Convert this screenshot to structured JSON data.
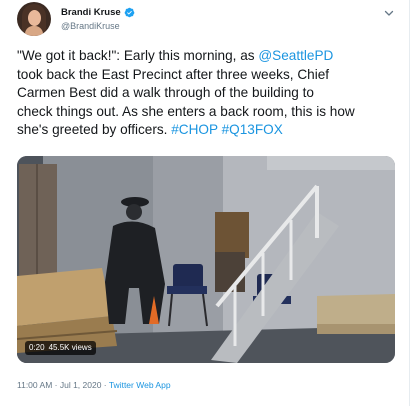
{
  "author": {
    "display_name": "Brandi Kruse",
    "handle": "@BrandiKruse",
    "verified": true
  },
  "tweet": {
    "lines": [
      [
        {
          "text": "\"We got it back!\": Early this morning, as ",
          "link": false
        },
        {
          "text": "@SeattlePD",
          "link": true
        }
      ],
      [
        {
          "text": "took back the East Precinct after three weeks, Chief",
          "link": false
        }
      ],
      [
        {
          "text": "Carmen Best did a walk through of the building to",
          "link": false
        }
      ],
      [
        {
          "text": "check things out. As she enters a back room, this is how",
          "link": false
        }
      ],
      [
        {
          "text": "she's greeted by officers. ",
          "link": false
        },
        {
          "text": "#CHOP",
          "link": true
        },
        {
          "text": " ",
          "link": false
        },
        {
          "text": "#Q13FOX",
          "link": true
        }
      ]
    ]
  },
  "video": {
    "duration": "0:20",
    "views": "45.5K views"
  },
  "footer": {
    "timestamp": "11:00 AM · Jul 1, 2020 · ",
    "source": "Twitter Web App"
  },
  "colors": {
    "link": "#1b95e0",
    "verified": "#1da1f2",
    "secondary_text": "#657786"
  },
  "icons": {
    "verified": "verified-badge-icon",
    "menu": "chevron-down-icon"
  }
}
